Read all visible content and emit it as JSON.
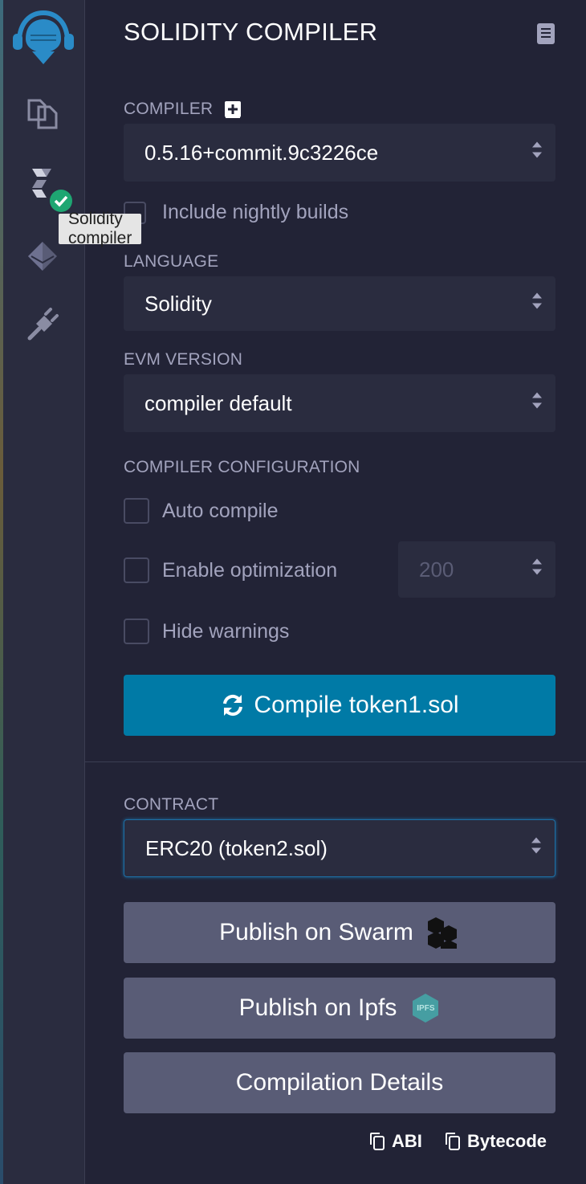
{
  "sidebar": {
    "icons": [
      "remix-logo-icon",
      "file-explorer-icon",
      "solidity-compiler-icon",
      "deploy-run-icon",
      "plugin-manager-icon"
    ],
    "tooltip": "Solidity compiler"
  },
  "header": {
    "title": "SOLIDITY COMPILER"
  },
  "compiler": {
    "label": "COMPILER",
    "selected": "0.5.16+commit.9c3226ce",
    "nightly_label": "Include nightly builds"
  },
  "language": {
    "label": "LANGUAGE",
    "selected": "Solidity"
  },
  "evm": {
    "label": "EVM VERSION",
    "selected": "compiler default"
  },
  "config": {
    "label": "COMPILER CONFIGURATION",
    "auto_compile": "Auto compile",
    "enable_optimization": "Enable optimization",
    "runs_placeholder": "200",
    "hide_warnings": "Hide warnings"
  },
  "compile_button": "Compile token1.sol",
  "contract": {
    "label": "CONTRACT",
    "selected": "ERC20 (token2.sol)"
  },
  "publish": {
    "swarm": "Publish on Swarm",
    "ipfs": "Publish on Ipfs",
    "ipfs_badge": "IPFS",
    "details": "Compilation Details"
  },
  "copy": {
    "abi": "ABI",
    "bytecode": "Bytecode"
  },
  "colors": {
    "primary": "#007aa6",
    "secondary": "#595c76",
    "background": "#222336",
    "success": "#1ea672"
  }
}
